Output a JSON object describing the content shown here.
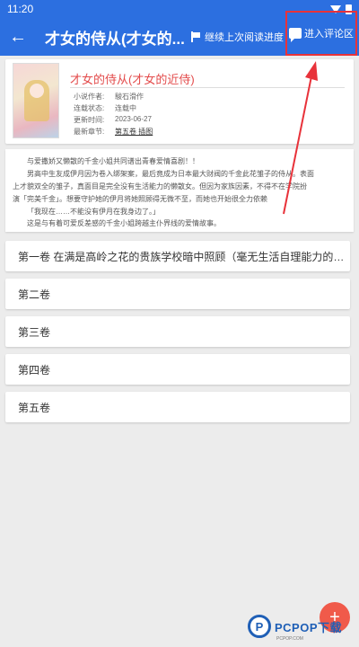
{
  "status_bar": {
    "time": "11:20"
  },
  "app_bar": {
    "back_label": "←",
    "title": "才女的侍从(才女的...",
    "resume_label": "继续上次阅读进度",
    "comment_label": "进入评论区"
  },
  "book": {
    "title": "才女的侍从(才女的近侍)",
    "author_label": "小说作者:",
    "author": "駿石滑作",
    "status_label": "连载状态:",
    "status": "连载中",
    "updated_label": "更新时间:",
    "updated": "2023-06-27",
    "latest_label": "最新章节:",
    "latest": "第五卷 插图"
  },
  "description": [
    "与爱撒娇又懒散的千金小姐共同谱出青春爱情喜剧！！",
    "男高中生友成伊月因为卷入绑架案，最后竟成为日本最大财阀的千金此花雏子的侍从。表面",
    "上才貌双全的雏子，真面目是完全没有生活能力的懒散女。但因为家族因素，不得不在学院扮",
    "演「完美千金」。想要守护她的伊月将她照顾得无微不至，而她也开始很全力依赖",
    "「我现在……不能没有伊月在我身边了。」",
    "这是与有着可爱反差感的千金小姐跨越主仆界线的爱情故事。"
  ],
  "volumes": [
    "第一卷 在满是高岭之花的贵族学校暗中照顾（毫无生活自理能力的…",
    "第二卷",
    "第三卷",
    "第四卷",
    "第五卷"
  ],
  "fab": {
    "label": "+"
  },
  "watermark": {
    "logo": "P",
    "text": "PCPOP下载",
    "sub": "PCPOP.COM"
  },
  "colors": {
    "primary": "#2c6fe0",
    "accent": "#e34b4b",
    "highlight": "#e8323a",
    "fab": "#f05a4a"
  }
}
